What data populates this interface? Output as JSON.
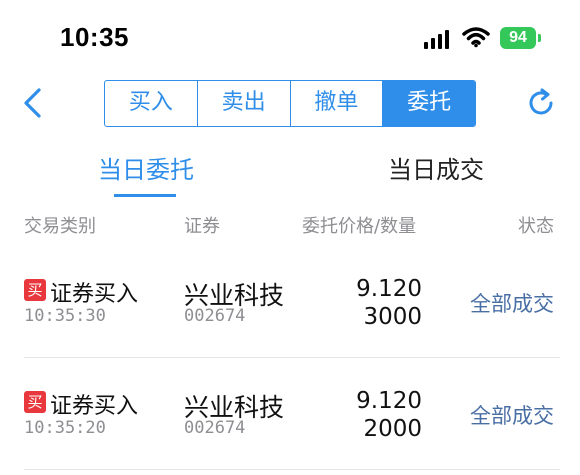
{
  "status_bar": {
    "time": "10:35",
    "battery": "94",
    "icons": [
      "cellular-signal-icon",
      "wifi-icon",
      "battery-icon"
    ]
  },
  "nav": {
    "back_icon": "chevron-left-icon",
    "refresh_icon": "refresh-icon",
    "segments": [
      {
        "label": "买入",
        "active": false
      },
      {
        "label": "卖出",
        "active": false
      },
      {
        "label": "撤单",
        "active": false
      },
      {
        "label": "委托",
        "active": true
      }
    ],
    "accent_color": "#2f8ee9"
  },
  "subtabs": [
    {
      "label": "当日委托",
      "active": true
    },
    {
      "label": "当日成交",
      "active": false
    }
  ],
  "table": {
    "headers": [
      "交易类别",
      "证券",
      "委托价格/数量",
      "状态"
    ],
    "rows": [
      {
        "badge": "买",
        "type": "证券买入",
        "time": "10:35:30",
        "name": "兴业科技",
        "code": "002674",
        "price": "9.120",
        "qty": "3000",
        "status": "全部成交"
      },
      {
        "badge": "买",
        "type": "证券买入",
        "time": "10:35:20",
        "name": "兴业科技",
        "code": "002674",
        "price": "9.120",
        "qty": "2000",
        "status": "全部成交"
      }
    ]
  },
  "colors": {
    "buy_badge": "#e8383d",
    "status_text": "#4a6fa5",
    "battery": "#34c759"
  }
}
